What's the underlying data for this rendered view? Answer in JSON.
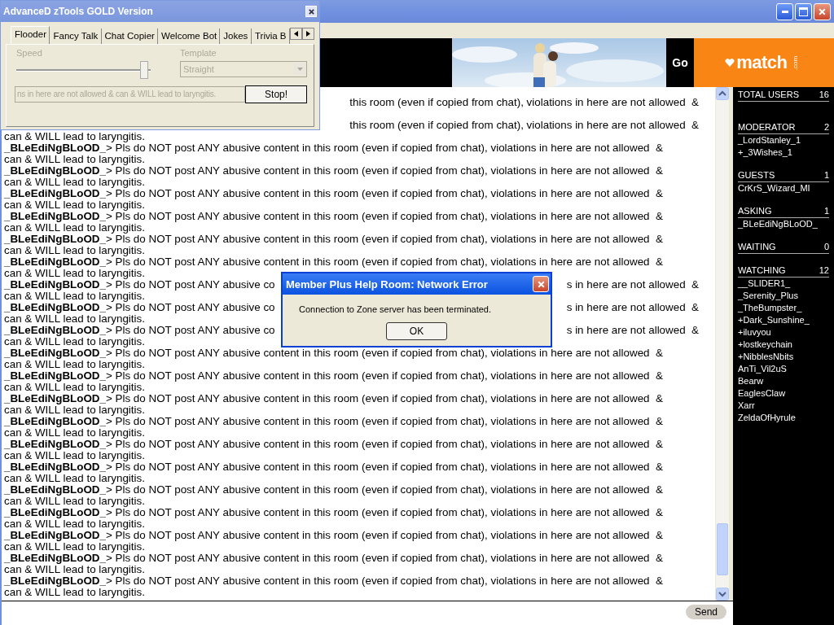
{
  "banner": {
    "go_label": "Go",
    "logo": "match",
    "logo_suffix": ".com"
  },
  "chat": {
    "messages": [
      {
        "text_after": "this room (even if copied from chat), violations in here are not allowed  &"
      },
      {
        "text_after": "this room (even if copied from chat), violations in here are not allowed  &",
        "continuation": "can & WILL lead to laryngitis."
      },
      {
        "author": "_BLeEdiNgBLoOD_",
        "text": "> Pls do NOT post ANY abusive content in this room (even if copied from chat), violations in here are not allowed  &",
        "continuation": "can & WILL lead to laryngitis."
      },
      {
        "author": "_BLeEdiNgBLoOD_",
        "text": "> Pls do NOT post ANY abusive content in this room (even if copied from chat), violations in here are not allowed  &",
        "continuation": "can & WILL lead to laryngitis."
      },
      {
        "author": "_BLeEdiNgBLoOD_",
        "text": "> Pls do NOT post ANY abusive content in this room (even if copied from chat), violations in here are not allowed  &",
        "continuation": "can & WILL lead to laryngitis."
      },
      {
        "author": "_BLeEdiNgBLoOD_",
        "text": "> Pls do NOT post ANY abusive content in this room (even if copied from chat), violations in here are not allowed  &",
        "continuation": "can & WILL lead to laryngitis."
      },
      {
        "author": "_BLeEdiNgBLoOD_",
        "text": "> Pls do NOT post ANY abusive content in this room (even if copied from chat), violations in here are not allowed  &",
        "continuation": "can & WILL lead to laryngitis."
      },
      {
        "author": "_BLeEdiNgBLoOD_",
        "text": "> Pls do NOT post ANY abusive content in this room (even if copied from chat), violations in here are not allowed  &",
        "continuation": "can & WILL lead to laryngitis."
      },
      {
        "author": "_BLeEdiNgBLoOD_",
        "text": "> Pls do NOT post ANY abusive co",
        "text_after": "s in here are not allowed  &",
        "continuation": "can & WILL lead to laryngitis."
      },
      {
        "author": "_BLeEdiNgBLoOD_",
        "text": "> Pls do NOT post ANY abusive co",
        "text_after": "s in here are not allowed  &",
        "continuation": "can & WILL lead to laryngitis."
      },
      {
        "author": "_BLeEdiNgBLoOD_",
        "text": "> Pls do NOT post ANY abusive co",
        "text_after": "s in here are not allowed  &",
        "continuation": "can & WILL lead to laryngitis."
      },
      {
        "author": "_BLeEdiNgBLoOD_",
        "text": "> Pls do NOT post ANY abusive content in this room (even if copied from chat), violations in here are not allowed  &",
        "continuation": "can & WILL lead to laryngitis."
      },
      {
        "author": "_BLeEdiNgBLoOD_",
        "text": "> Pls do NOT post ANY abusive content in this room (even if copied from chat), violations in here are not allowed  &",
        "continuation": "can & WILL lead to laryngitis."
      },
      {
        "author": "_BLeEdiNgBLoOD_",
        "text": "> Pls do NOT post ANY abusive content in this room (even if copied from chat), violations in here are not allowed  &",
        "continuation": "can & WILL lead to laryngitis."
      },
      {
        "author": "_BLeEdiNgBLoOD_",
        "text": "> Pls do NOT post ANY abusive content in this room (even if copied from chat), violations in here are not allowed  &",
        "continuation": "can & WILL lead to laryngitis."
      },
      {
        "author": "_BLeEdiNgBLoOD_",
        "text": "> Pls do NOT post ANY abusive content in this room (even if copied from chat), violations in here are not allowed  &",
        "continuation": "can & WILL lead to laryngitis."
      },
      {
        "author": "_BLeEdiNgBLoOD_",
        "text": "> Pls do NOT post ANY abusive content in this room (even if copied from chat), violations in here are not allowed  &",
        "continuation": "can & WILL lead to laryngitis."
      },
      {
        "author": "_BLeEdiNgBLoOD_",
        "text": "> Pls do NOT post ANY abusive content in this room (even if copied from chat), violations in here are not allowed  &",
        "continuation": "can & WILL lead to laryngitis."
      },
      {
        "author": "_BLeEdiNgBLoOD_",
        "text": "> Pls do NOT post ANY abusive content in this room (even if copied from chat), violations in here are not allowed  &",
        "continuation": "can & WILL lead to laryngitis."
      },
      {
        "author": "_BLeEdiNgBLoOD_",
        "text": "> Pls do NOT post ANY abusive content in this room (even if copied from chat), violations in here are not allowed  &",
        "continuation": "can & WILL lead to laryngitis."
      },
      {
        "author": "_BLeEdiNgBLoOD_",
        "text": "> Pls do NOT post ANY abusive content in this room (even if copied from chat), violations in here are not allowed  &",
        "continuation": "can & WILL lead to laryngitis."
      },
      {
        "author": "_BLeEdiNgBLoOD_",
        "text": "> Pls do NOT post ANY abusive content in this room (even if copied from chat), violations in here are not allowed  &",
        "continuation": "can & WILL lead to laryngitis."
      }
    ]
  },
  "send_button": "Send",
  "user_list": [
    {
      "title": "TOTAL USERS",
      "count": "16"
    },
    {
      "title": "MODERATOR",
      "count": "2",
      "members": [
        "_LordStanley_1",
        "+_3Wishes_1"
      ]
    },
    {
      "title": "GUESTS",
      "count": "1",
      "members": [
        "CrKrS_Wizard_MI"
      ]
    },
    {
      "title": "ASKING",
      "count": "1",
      "members": [
        "_BLeEdiNgBLoOD_"
      ]
    },
    {
      "title": "WAITING",
      "count": "0"
    },
    {
      "title": "WATCHING",
      "count": "12",
      "members": [
        "__SLIDER1_",
        "_Serenity_Plus",
        "_TheBumpster_",
        "+Dark_Sunshine_",
        "+iluvyou",
        "+lostkeychain",
        "+NibblesNbits",
        "AnTi_Vil2uS",
        "Bearw",
        "EaglesClaw",
        "Xarr",
        "ZeldaOfHyrule"
      ]
    }
  ],
  "tools_window": {
    "title": "AdvanceD zTools GOLD Version",
    "tabs": [
      {
        "label": "Flooder",
        "selected": true
      },
      {
        "label": "Fancy Talk",
        "selected": false
      },
      {
        "label": "Chat Copier",
        "selected": false
      },
      {
        "label": "Welcome Bot",
        "selected": false
      },
      {
        "label": "Jokes",
        "selected": false
      },
      {
        "label": "Trivia B",
        "selected": false
      }
    ],
    "speed": {
      "label": "Speed",
      "level": 0.95,
      "disabled": true
    },
    "template": {
      "label": "Template",
      "value": "Straight",
      "disabled": true
    },
    "message": {
      "value": "ns in here are not allowed  & can & WILL lead to laryngitis.",
      "disabled": true
    },
    "stop_button": "Stop!"
  },
  "dialog": {
    "title": "Member Plus Help Room: Network Error",
    "message": "Connection to Zone server has been terminated.",
    "ok_button": "OK"
  }
}
